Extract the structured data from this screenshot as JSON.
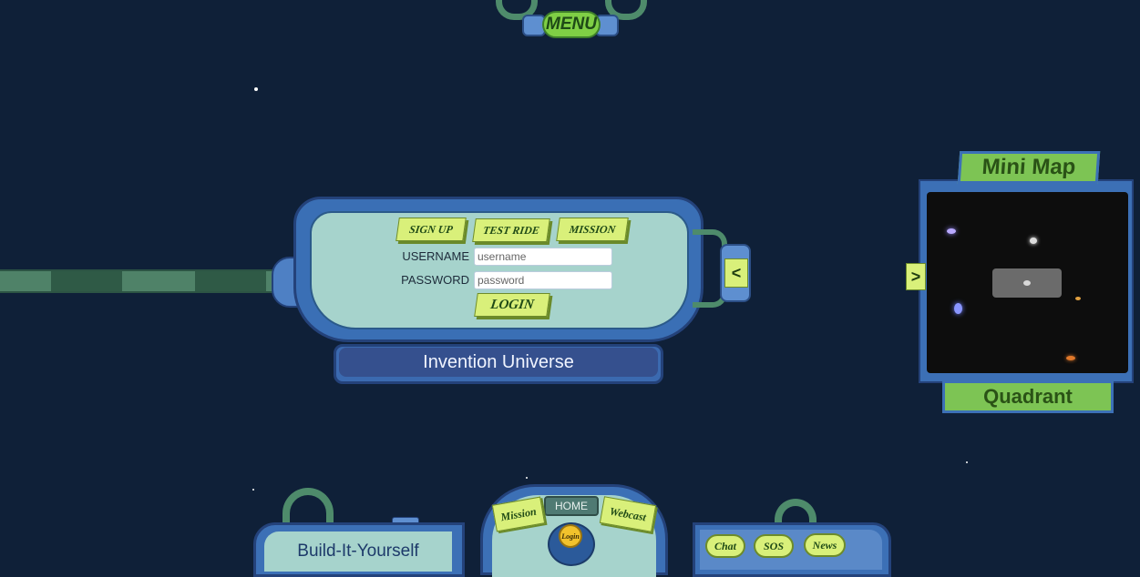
{
  "menu": {
    "label": "MENU"
  },
  "login": {
    "tabs": [
      {
        "label": "SIGN UP"
      },
      {
        "label": "TEST RIDE"
      },
      {
        "label": "MISSION"
      }
    ],
    "username_label": "USERNAME",
    "username_placeholder": "username",
    "password_label": "PASSWORD",
    "password_placeholder": "password",
    "login_button": "LOGIN",
    "collapse_arrow": "<",
    "title": "Invention Universe"
  },
  "minimap": {
    "title": "Mini Map",
    "footer": "Quadrant",
    "expand_arrow": ">"
  },
  "dock": {
    "left_label": "Build-It-Yourself",
    "home_label": "HOME",
    "mission_label": "Mission",
    "webcast_label": "Webcast",
    "login_label": "Login",
    "right_buttons": [
      {
        "label": "Chat"
      },
      {
        "label": "SOS"
      },
      {
        "label": "News"
      }
    ]
  },
  "colors": {
    "background": "#0f2038",
    "panel_blue": "#3c70b6",
    "panel_teal": "#a6d3cc",
    "button_lime": "#d9f07a",
    "accent_green": "#7dc454"
  }
}
